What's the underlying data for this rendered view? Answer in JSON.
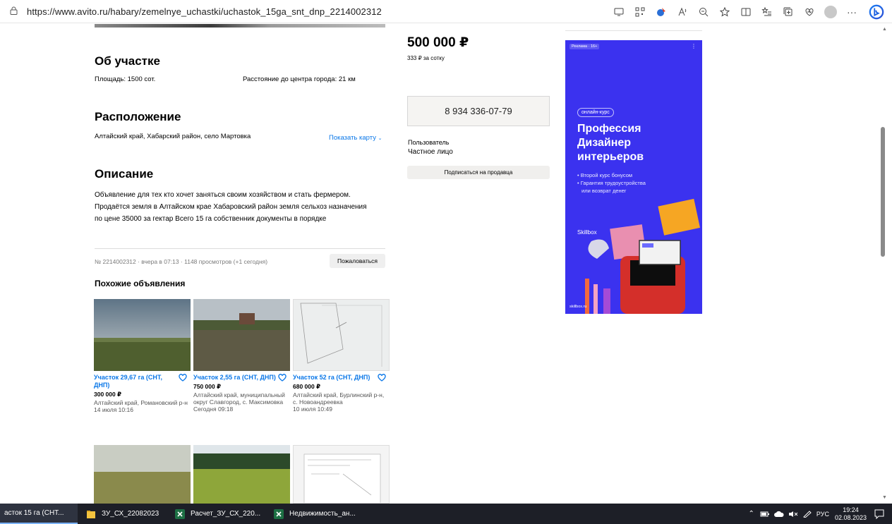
{
  "browser": {
    "url": "https://www.avito.ru/habary/zemelnye_uchastki/uchastok_15ga_snt_dnp_2214002312",
    "more_label": "···"
  },
  "about": {
    "title": "Об участке",
    "area_label": "Площадь:",
    "area_value": "1500 сот.",
    "distance_label": "Расстояние до центра города:",
    "distance_value": "21 км"
  },
  "location": {
    "title": "Расположение",
    "address": "Алтайский край, Хабарский район, село Мартовка",
    "show_map": "Показать карту"
  },
  "description": {
    "title": "Описание",
    "lines": [
      "Объявление для тех кто хочет заняться своим хозяйством и стать фермером.",
      "Продаётся земля в Алтайском крае Хабаровский район земля сельхоз назначения",
      "по цене 35000 за гектар Всего 15 га собственник документы в порядке"
    ]
  },
  "listing": {
    "price": "500 000 ₽",
    "price_per": "333 ₽ за сотку",
    "phone": "8 934 336-07-79",
    "seller_type": "Пользователь",
    "seller_name": "Частное лицо",
    "subscribe": "Подписаться на продавца",
    "meta": "№ 2214002312 · вчера в 07:13 · 1148 просмотров (+1 сегодня)",
    "report": "Пожаловаться"
  },
  "similar": {
    "title": "Похожие объявления",
    "cards": [
      {
        "title": "Участок 29,67 га (СНТ, ДНП)",
        "price": "300 000 ₽",
        "location": "Алтайский край, Романовский р-н",
        "date": "14 июля 10:16"
      },
      {
        "title": "Участок 2,55 га (СНТ, ДНП)",
        "price": "750 000 ₽",
        "location": "Алтайский край, муниципальный округ Славгород, с. Максимовка",
        "date": "Сегодня 09:18"
      },
      {
        "title": "Участок 52 га (СНТ, ДНП)",
        "price": "680 000 ₽",
        "location": "Алтайский край, Бурлинский р-н, с. Новоандреевка",
        "date": "10 июля 10:49"
      }
    ]
  },
  "ad": {
    "label": "Реклама · 16+",
    "badge": "онлайн-курс",
    "headline_1": "Профессия",
    "headline_2": "Дизайнер",
    "headline_3": "интерьеров",
    "bullet_1": "• Второй курс бонусом",
    "bullet_2": "• Гарантия трудоустройства",
    "bullet_3": "  или возврат денег",
    "brand": "Skillbox",
    "footer": "skillbox.ru",
    "bg_color": "#3b32ef"
  },
  "taskbar": {
    "items": [
      {
        "label": "асток 15 га (СНТ..."
      },
      {
        "label": "ЗУ_СХ_22082023"
      },
      {
        "label": "Расчет_ЗУ_СХ_220..."
      },
      {
        "label": "Недвижимость_ан..."
      }
    ],
    "lang": "РУС",
    "time": "19:24",
    "date": "02.08.2023"
  }
}
